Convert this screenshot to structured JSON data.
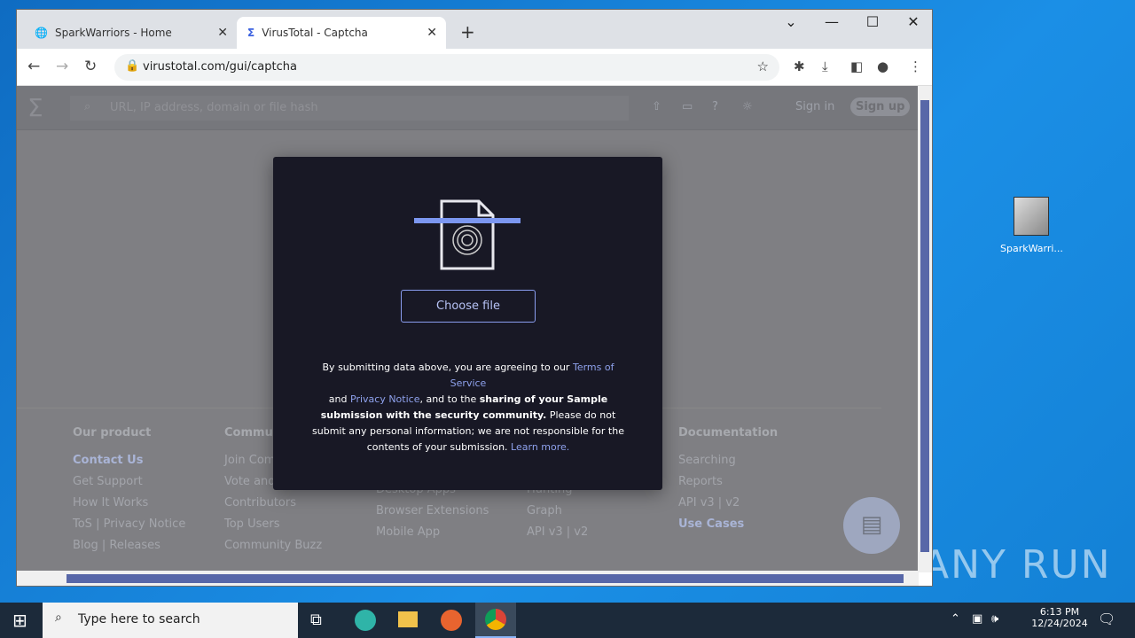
{
  "browser": {
    "tabs": [
      {
        "title": "SparkWarriors - Home",
        "icon": "globe-icon"
      },
      {
        "title": "VirusTotal - Captcha",
        "icon": "virustotal-icon"
      }
    ],
    "url": "virustotal.com/gui/captcha"
  },
  "header": {
    "search_placeholder": "URL, IP address, domain or file hash",
    "sign_in": "Sign in",
    "sign_up": "Sign up"
  },
  "modal": {
    "choose_file": "Choose file",
    "terms_1": "By submitting data above, you are agreeing to our ",
    "terms_link": "Terms of Service",
    "and": "and ",
    "privacy_link": "Privacy Notice",
    "terms_2": ", and to the ",
    "terms_bold": "sharing of your Sample submission with the security community.",
    "terms_3": " Please do not submit any personal information; we are not responsible for the contents of your submission. ",
    "learn_more": "Learn more."
  },
  "footer": {
    "columns": [
      {
        "title": "Our product",
        "items": [
          "Contact Us",
          "Get Support",
          "How It Works",
          "ToS | Privacy Notice",
          "Blog | Releases"
        ]
      },
      {
        "title": "Commun",
        "items": [
          "Join Com",
          "Vote and",
          "Contributors",
          "Top Users",
          "Community Buzz"
        ]
      },
      {
        "title": "",
        "items": [
          "",
          "",
          "Desktop Apps",
          "Browser Extensions",
          "Mobile App"
        ]
      },
      {
        "title": "",
        "items": [
          "",
          "",
          "Hunting",
          "Graph",
          "API v3 | v2"
        ]
      },
      {
        "title": "Documentation",
        "items": [
          "Searching",
          "Reports",
          "API v3 | v2",
          "Use Cases"
        ]
      }
    ]
  },
  "desktop": {
    "icon_label": "SparkWarri...",
    "watermark": "ANY RUN"
  },
  "taskbar": {
    "search_placeholder": "Type here to search",
    "time": "6:13 PM",
    "date": "12/24/2024"
  }
}
